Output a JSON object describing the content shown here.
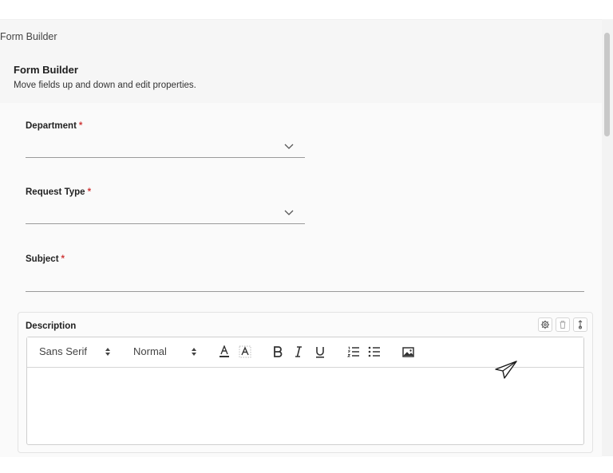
{
  "app": {
    "title": "Form Builder"
  },
  "header": {
    "title": "Form Builder",
    "subtitle": "Move fields up and down and edit properties."
  },
  "fields": [
    {
      "label": "Department",
      "required_mark": "*",
      "type": "select",
      "value": ""
    },
    {
      "label": "Request Type",
      "required_mark": "*",
      "type": "select",
      "value": ""
    },
    {
      "label": "Subject",
      "required_mark": "*",
      "type": "text",
      "value": ""
    }
  ],
  "description": {
    "label": "Description",
    "toolbar": {
      "font_family": "Sans Serif",
      "font_size": "Normal"
    },
    "field_actions": [
      "gear-icon",
      "trash-icon",
      "move-icon"
    ],
    "content": ""
  },
  "colors": {
    "required": "#d03b3b",
    "underline": "#9a9a9a"
  }
}
